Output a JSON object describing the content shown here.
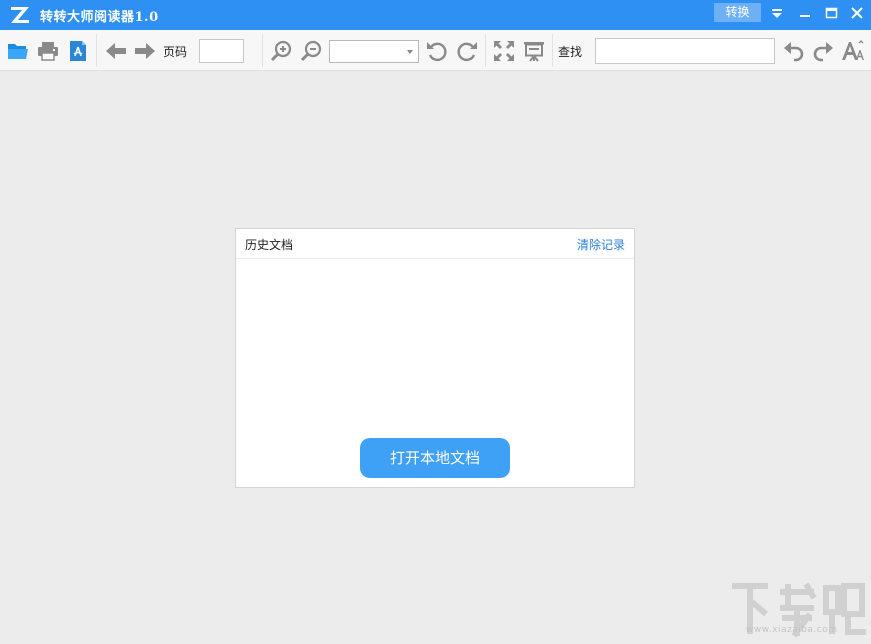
{
  "titlebar": {
    "title": "转转大师阅读器1.0",
    "convert_label": "转换",
    "bg_color": "#2e90f2"
  },
  "window_controls": [
    "dropdown-arrow-icon",
    "minimize-icon",
    "maximize-icon",
    "close-icon"
  ],
  "toolbar": {
    "icons": [
      "open-folder-icon",
      "print-icon",
      "pdf-document-icon",
      "arrow-left-icon",
      "arrow-right-icon",
      "zoom-in-icon",
      "zoom-out-icon",
      "rotate-left-icon",
      "rotate-right-icon",
      "fullscreen-icon",
      "presentation-icon",
      "undo-icon",
      "redo-icon",
      "font-size-icon"
    ],
    "page_label": "页码",
    "page_value": "",
    "zoom_value": "",
    "search_label": "查找",
    "search_value": ""
  },
  "history": {
    "title": "历史文档",
    "clear_label": "清除记录",
    "items": [],
    "open_button_label": "打开本地文档"
  },
  "watermark": {
    "text": "下载吧",
    "url": "www.xiazaiba.com"
  },
  "colors": {
    "accent": "#3ea1f6",
    "link": "#2b7fd6",
    "background": "#ececec"
  }
}
